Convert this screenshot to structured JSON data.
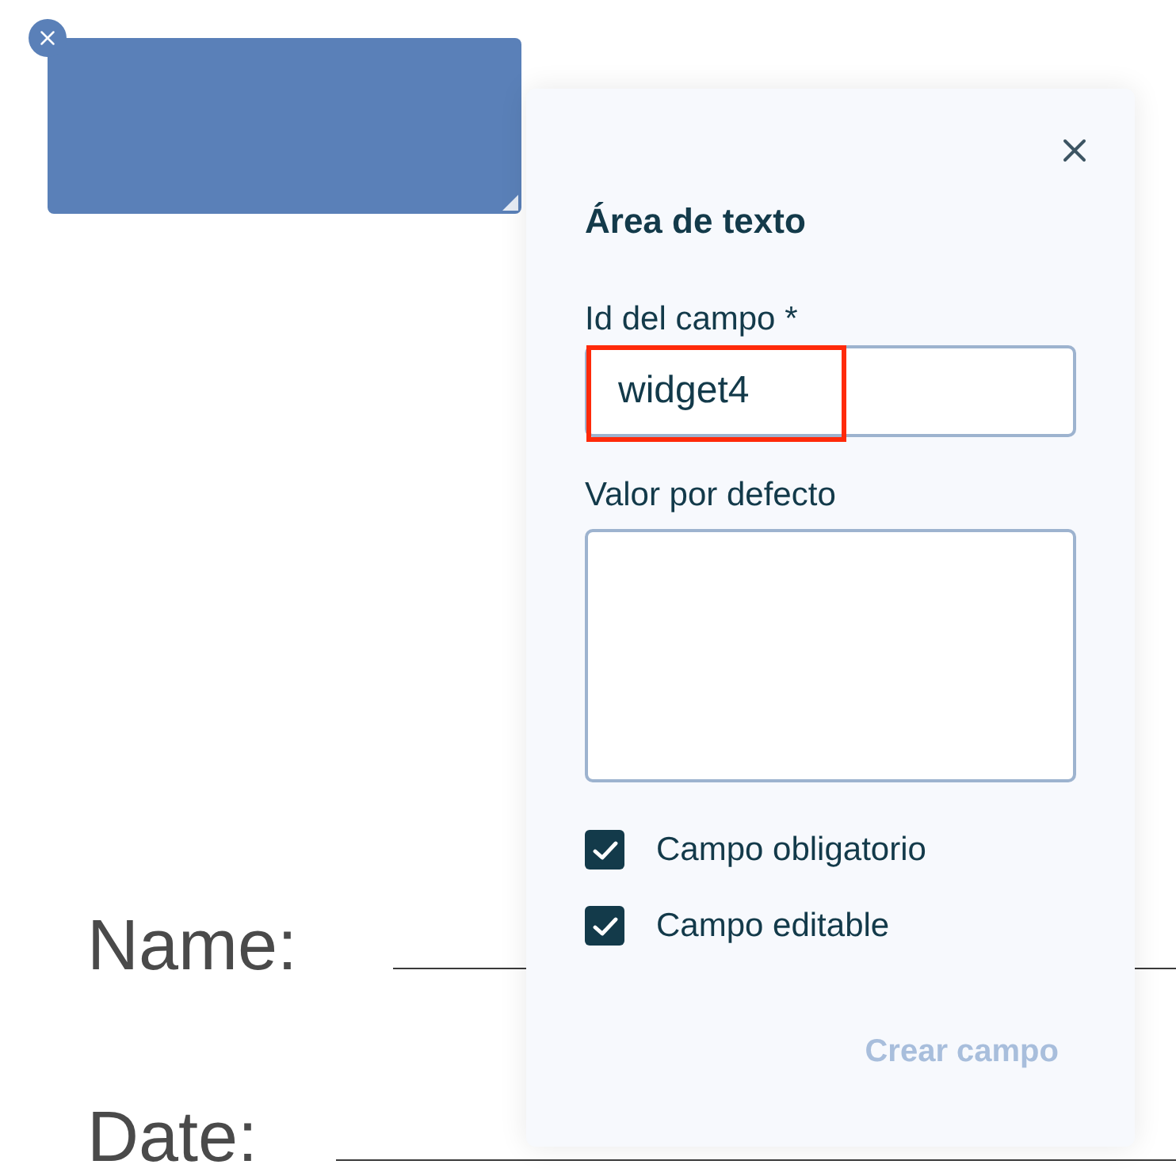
{
  "document": {
    "lines": [
      {
        "label": "Name:"
      },
      {
        "label": "Date:"
      }
    ]
  },
  "panel": {
    "title": "Área de texto",
    "fields": [
      {
        "kind": "text",
        "label": "Id del campo *",
        "value": "widget4",
        "highlighted": true
      },
      {
        "kind": "textarea",
        "label": "Valor por defecto",
        "highlighted": false
      }
    ],
    "options": [
      {
        "label": "Campo obligatorio",
        "checked": true
      },
      {
        "label": "Campo editable",
        "checked": true
      }
    ],
    "submit": {
      "label": "Crear campo",
      "disabled": true
    }
  }
}
